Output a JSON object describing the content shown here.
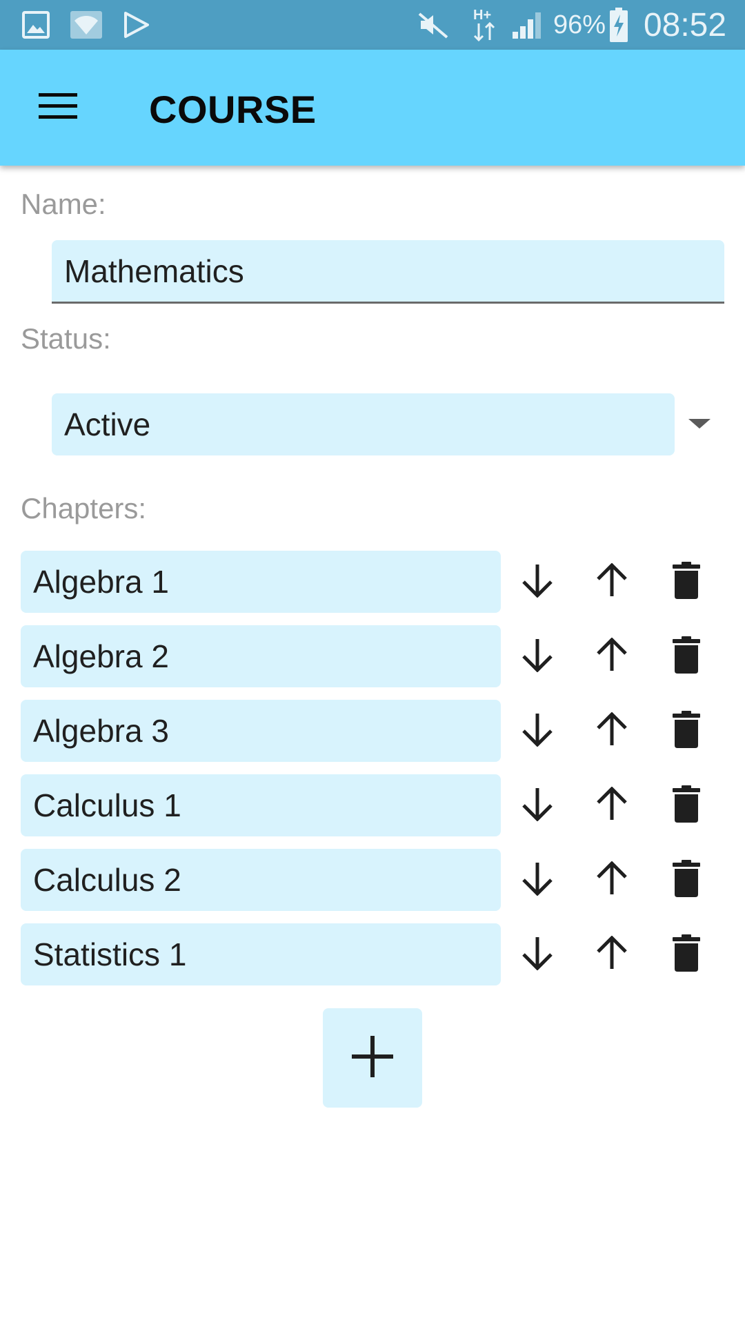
{
  "status_bar": {
    "icons": [
      "image-icon",
      "wifi-icon",
      "play-store-icon",
      "mute-icon",
      "network-hplus-icon",
      "signal-icon",
      "battery-charging-icon"
    ],
    "battery": "96%",
    "time": "08:52"
  },
  "app_bar": {
    "menu_icon": "menu-icon",
    "title": "COURSE"
  },
  "form": {
    "name_label": "Name:",
    "name_value": "Mathematics",
    "status_label": "Status:",
    "status_value": "Active",
    "chapters_label": "Chapters:"
  },
  "chapters": [
    {
      "name": "Algebra 1"
    },
    {
      "name": "Algebra 2"
    },
    {
      "name": "Algebra 3"
    },
    {
      "name": "Calculus 1"
    },
    {
      "name": "Calculus 2"
    },
    {
      "name": "Statistics 1"
    }
  ],
  "chapter_actions": [
    "arrow-down-icon",
    "arrow-up-icon",
    "trash-icon"
  ],
  "add_button_icon": "plus-icon",
  "colors": {
    "status_bar": "#4e9ec2",
    "app_bar": "#66d5fe",
    "field_background": "#d8f3fd",
    "label_text": "#9a9a9a",
    "icon": "#1f1f1f"
  }
}
